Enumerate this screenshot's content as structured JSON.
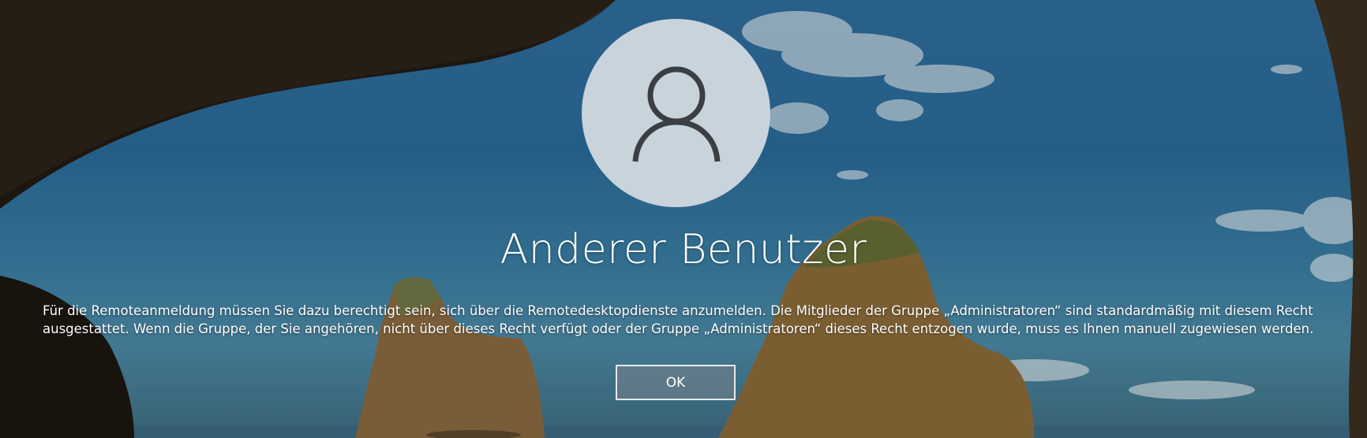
{
  "login_screen": {
    "user_name": "Anderer Benutzer",
    "avatar_icon": "user-silhouette-icon",
    "message": "Für die Remoteanmeldung müssen Sie dazu berechtigt sein, sich über die Remotedesktopdienste anzumelden. Die Mitglieder der Gruppe „Administratoren“ sind standardmäßig mit diesem Recht ausgestattet. Wenn die Gruppe, der Sie angehören, nicht über dieses Recht verfügt oder der Gruppe „Administratoren“ dieses Recht entzogen wurde, muss es Ihnen manuell zugewiesen werden.",
    "ok_label": "OK"
  },
  "colors": {
    "sky": "#2a6c99",
    "avatar_background": "#c9d3dc",
    "avatar_glyph": "#3b3f44",
    "text": "#ffffff"
  }
}
